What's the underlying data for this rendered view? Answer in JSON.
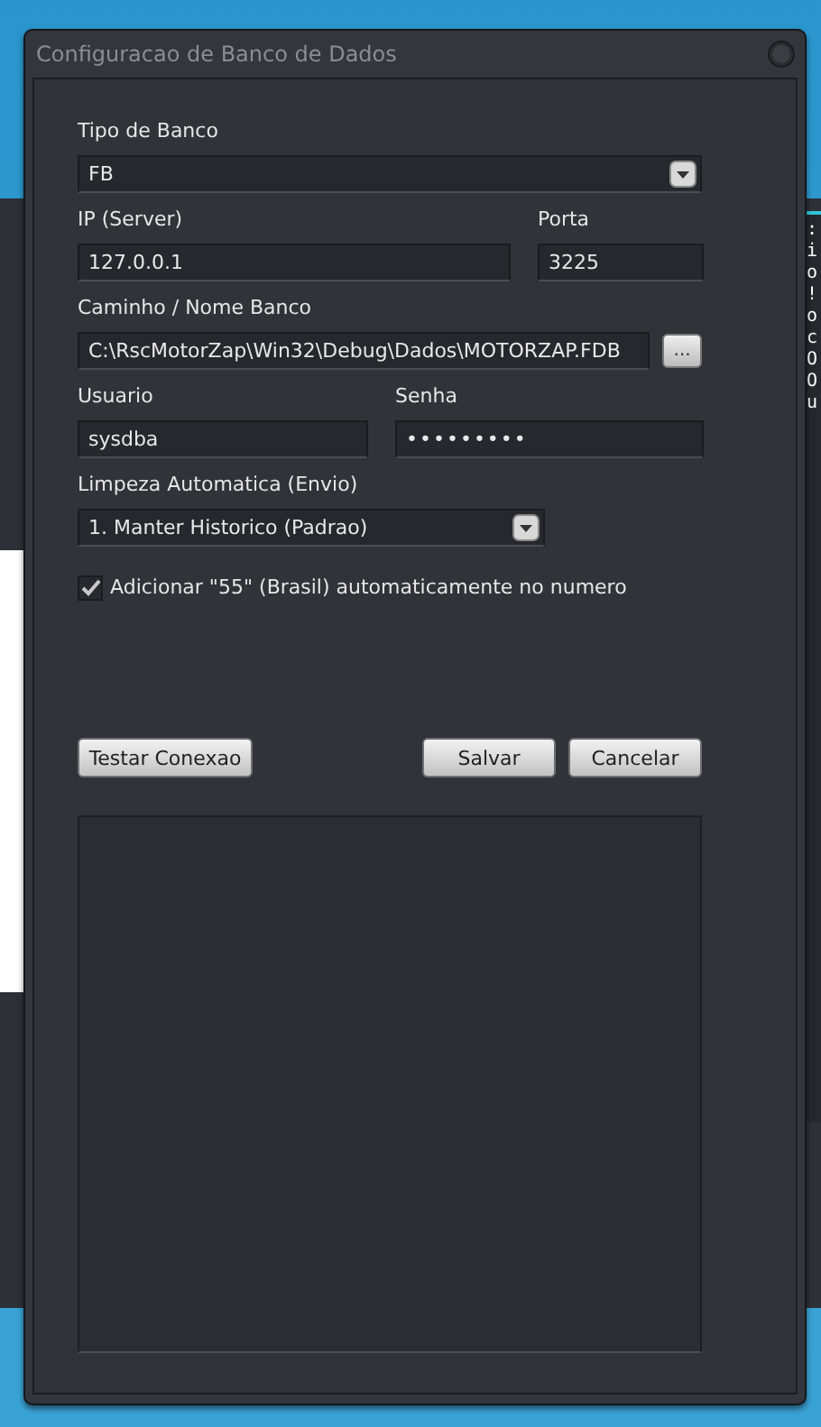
{
  "background_window": {
    "console_lines": [
      ":",
      "i",
      "o",
      "!",
      "o",
      "c",
      "O",
      "O",
      "u"
    ]
  },
  "window": {
    "title": "Configuracao de Banco de Dados"
  },
  "form": {
    "db_type": {
      "label": "Tipo de Banco",
      "value": "FB"
    },
    "ip": {
      "label": "IP (Server)",
      "value": "127.0.0.1"
    },
    "port": {
      "label": "Porta",
      "value": "3225"
    },
    "path": {
      "label": "Caminho / Nome Banco",
      "value": "C:\\RscMotorZap\\Win32\\Debug\\Dados\\MOTORZAP.FDB",
      "browse": "..."
    },
    "user": {
      "label": "Usuario",
      "value": "sysdba"
    },
    "password": {
      "label": "Senha",
      "value": "•••••••••"
    },
    "cleanup": {
      "label": "Limpeza Automatica (Envio)",
      "value": "1. Manter Historico (Padrao)"
    },
    "add_country_code": {
      "label": "Adicionar \"55\" (Brasil) automaticamente no numero",
      "checked": true
    }
  },
  "buttons": {
    "test": "Testar Conexao",
    "save": "Salvar",
    "cancel": "Cancelar"
  }
}
